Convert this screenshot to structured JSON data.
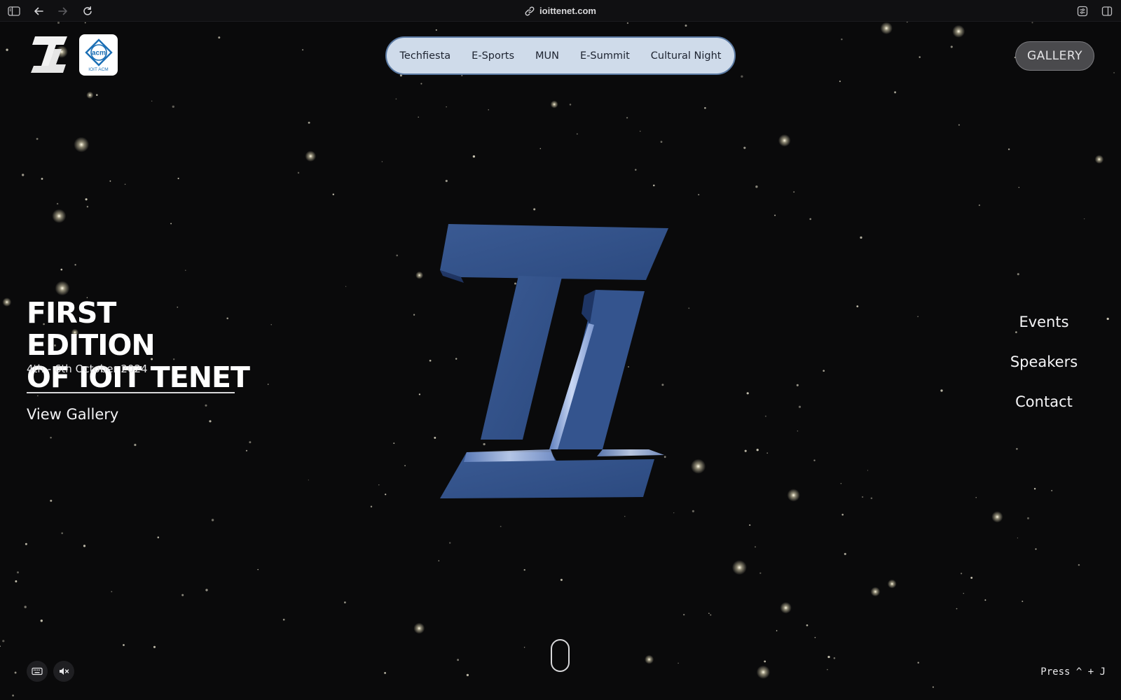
{
  "browser": {
    "url": "ioittenet.com",
    "icons": [
      "sidebar-icon",
      "back-icon",
      "forward-icon",
      "reload-icon",
      "link-icon",
      "extension-icon",
      "split-view-icon"
    ]
  },
  "header": {
    "acm_logo_text": "acm",
    "acm_caption": "IOIT ACM",
    "nav": [
      {
        "label": "Techfiesta"
      },
      {
        "label": "E-Sports"
      },
      {
        "label": "MUN"
      },
      {
        "label": "E-Summit"
      },
      {
        "label": "Cultural Night"
      }
    ],
    "gallery_label": "GALLERY"
  },
  "hero": {
    "title_line1": "FIRST EDITION",
    "title_line2": "OF IOIT TENET",
    "date": "4th - 6th October 2024",
    "view_gallery": "View Gallery"
  },
  "side_nav": [
    {
      "label": "Events"
    },
    {
      "label": "Speakers"
    },
    {
      "label": "Contact"
    }
  ],
  "footer": {
    "press_hint": "Press ^ + J",
    "controls": [
      "keyboard-icon",
      "mute-icon"
    ]
  },
  "colors": {
    "background": "#0a0a0b",
    "pill_nav_bg": "#cfdbea",
    "logo_blue": "#2f4f86"
  }
}
